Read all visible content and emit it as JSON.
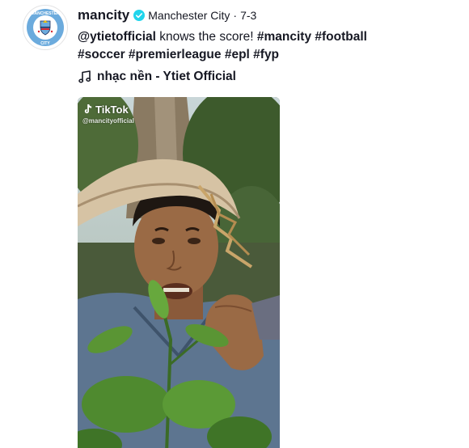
{
  "post": {
    "username": "mancity",
    "nickname": "Manchester City",
    "separator": "·",
    "date": "7-3",
    "caption": {
      "mention": "@ytietofficial",
      "text": " knows the score! ",
      "hashtags_line1": [
        "#mancity",
        "#football"
      ],
      "hashtags_line2": [
        "#soccer",
        "#premierleague",
        "#epl",
        "#fyp"
      ]
    },
    "music": {
      "icon": "music-note-icon",
      "label": "nhạc nền - Ytiet Official"
    }
  },
  "avatar": {
    "icon": "manchester-city-crest",
    "colors": {
      "blue": "#6cabdd",
      "navy": "#1c2c5b",
      "gold": "#f2c100",
      "red": "#d7282f"
    }
  },
  "video": {
    "watermark_brand": "TikTok",
    "watermark_handle": "@mancityofficial"
  },
  "colors": {
    "text": "#161823",
    "verified": "#20d5ec"
  }
}
